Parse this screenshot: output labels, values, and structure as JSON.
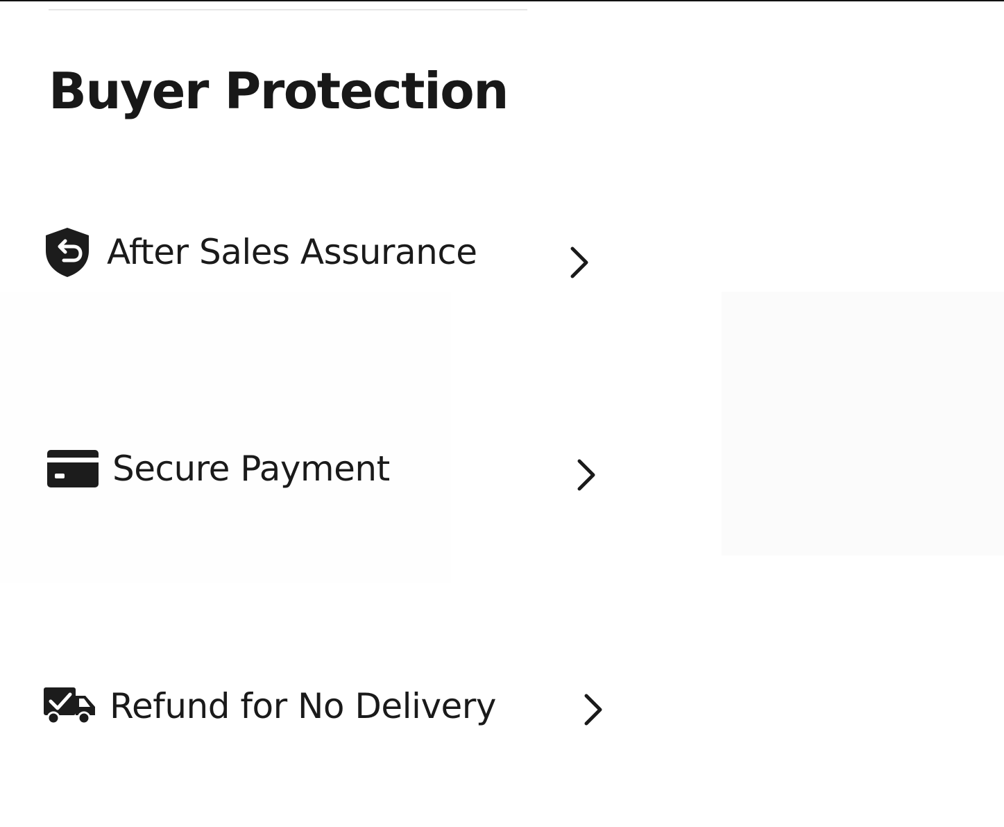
{
  "page": {
    "title": "Buyer Protection"
  },
  "items": [
    {
      "label": "After Sales Assurance",
      "icon": "shield-return-icon"
    },
    {
      "label": "Secure Payment",
      "icon": "credit-card-icon"
    },
    {
      "label": "Refund for No Delivery",
      "icon": "delivery-truck-check-icon"
    }
  ],
  "colors": {
    "text": "#1a1a1a",
    "icon": "#1c1c1c",
    "background": "#ffffff"
  }
}
